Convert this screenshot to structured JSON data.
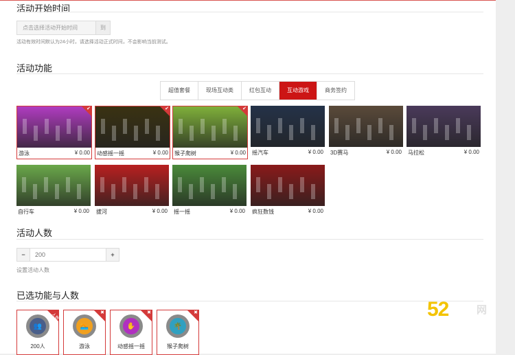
{
  "start_time": {
    "title": "活动开始时间",
    "placeholder": "点击选择活动开始时间",
    "to_label": "到",
    "hint": "活动有效时间默认为24小时，请选择活动正式时间，不会影响当前测试。"
  },
  "features": {
    "title": "活动功能",
    "tabs": [
      "超值套餐",
      "现场互动类",
      "红包互动",
      "互动游戏",
      "商务签约"
    ],
    "active_tab": "互动游戏",
    "cards": [
      {
        "label": "游泳",
        "price": "¥ 0.00",
        "selected": true,
        "color": "#b03cc0"
      },
      {
        "label": "动感摇一摇",
        "price": "¥ 0.00",
        "selected": true,
        "color": "#3a3212"
      },
      {
        "label": "猴子爬树",
        "price": "¥ 0.00",
        "selected": true,
        "color": "#7fb03a"
      },
      {
        "label": "摇汽车",
        "price": "¥ 0.00",
        "selected": false,
        "color": "#243248"
      },
      {
        "label": "3D赛马",
        "price": "¥ 0.00",
        "selected": false,
        "color": "#5a4a3a"
      },
      {
        "label": "马拉松",
        "price": "¥ 0.00",
        "selected": false,
        "color": "#4a3a5a"
      },
      {
        "label": "自行车",
        "price": "¥ 0.00",
        "selected": false,
        "color": "#6aa84a"
      },
      {
        "label": "拔河",
        "price": "¥ 0.00",
        "selected": false,
        "color": "#b82020"
      },
      {
        "label": "摇一摇",
        "price": "¥ 0.00",
        "selected": false,
        "color": "#4a8a3a"
      },
      {
        "label": "疯狂数钱",
        "price": "¥ 0.00",
        "selected": false,
        "color": "#8a1a1a"
      }
    ]
  },
  "participants": {
    "title": "活动人数",
    "minus": "−",
    "plus": "+",
    "value": "200",
    "hint": "设置活动人数"
  },
  "selected": {
    "title": "已选功能与人数",
    "items": [
      {
        "label": "200人",
        "icon": "users-icon",
        "color": "#4a5f8a",
        "ribbon": "人数"
      },
      {
        "label": "游泳",
        "icon": "swim-icon",
        "color": "#f0a020"
      },
      {
        "label": "动感摇一摇",
        "icon": "shake-icon",
        "color": "#b030c0"
      },
      {
        "label": "猴子爬树",
        "icon": "tree-icon",
        "color": "#30a0c0"
      }
    ]
  },
  "watermark": {
    "text": "52",
    "text2": "网"
  }
}
